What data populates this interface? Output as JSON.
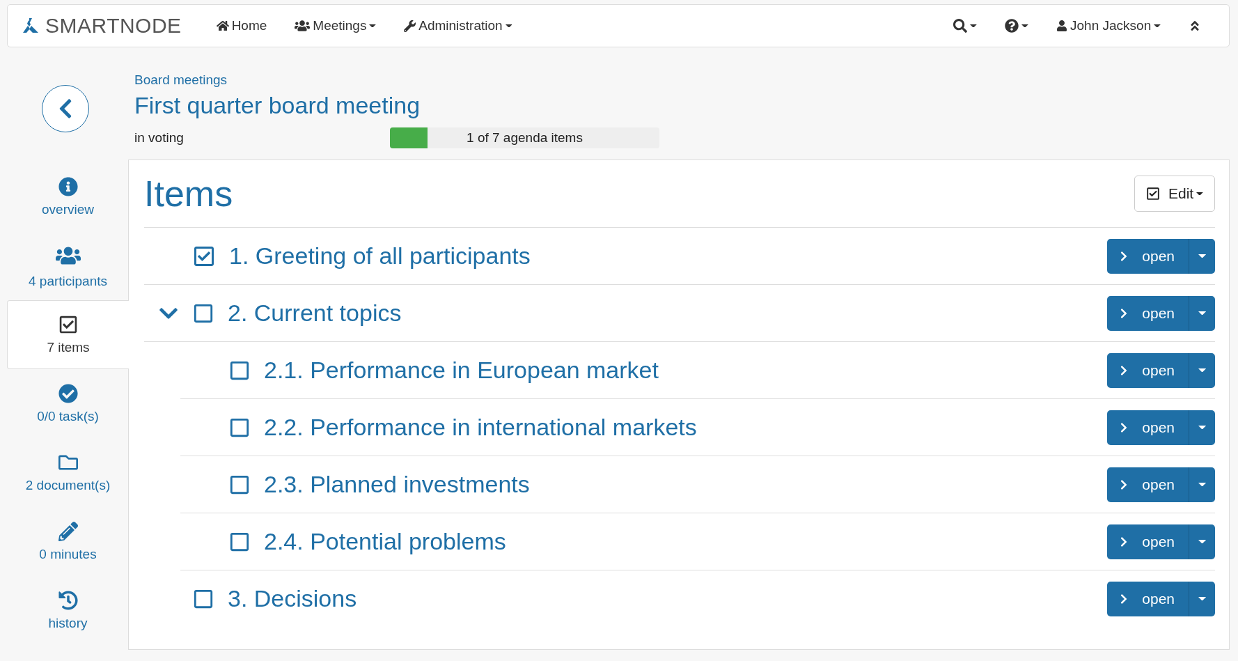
{
  "navbar": {
    "brand": "SMARTNODE",
    "menu": [
      {
        "label": "Home",
        "kind": "link"
      },
      {
        "label": "Meetings",
        "kind": "dropdown"
      },
      {
        "label": "Administration",
        "kind": "dropdown"
      }
    ],
    "user": "John Jackson"
  },
  "header": {
    "breadcrumb": "Board meetings",
    "title": "First quarter board meeting",
    "status": "in voting",
    "progress": {
      "level": 0.14,
      "label": "1 of 7 agenda items"
    }
  },
  "sidebar": {
    "items": [
      {
        "label": "overview",
        "selected": false
      },
      {
        "label": "4 participants",
        "selected": false
      },
      {
        "label": "7 items",
        "selected": true
      },
      {
        "label": "0/0 task(s)",
        "selected": false
      },
      {
        "label": "2 document(s)",
        "selected": false
      },
      {
        "label": "0 minutes",
        "selected": false
      },
      {
        "label": "history",
        "selected": false
      }
    ]
  },
  "panel": {
    "title": "Items",
    "edit_button": "Edit",
    "items": [
      {
        "label": "1. Greeting of all participants",
        "checked": true,
        "expanded": false,
        "action": "open"
      },
      {
        "label": "2. Current topics",
        "checked": false,
        "expanded": true,
        "action": "open",
        "children": [
          {
            "label": "2.1. Performance in European market",
            "checked": false,
            "action": "open"
          },
          {
            "label": "2.2. Performance in international markets",
            "checked": false,
            "action": "open"
          },
          {
            "label": "2.3. Planned investments",
            "checked": false,
            "action": "open"
          },
          {
            "label": "2.4. Potential problems",
            "checked": false,
            "action": "open"
          }
        ]
      },
      {
        "label": "3. Decisions",
        "checked": false,
        "expanded": false,
        "action": "open"
      }
    ]
  }
}
